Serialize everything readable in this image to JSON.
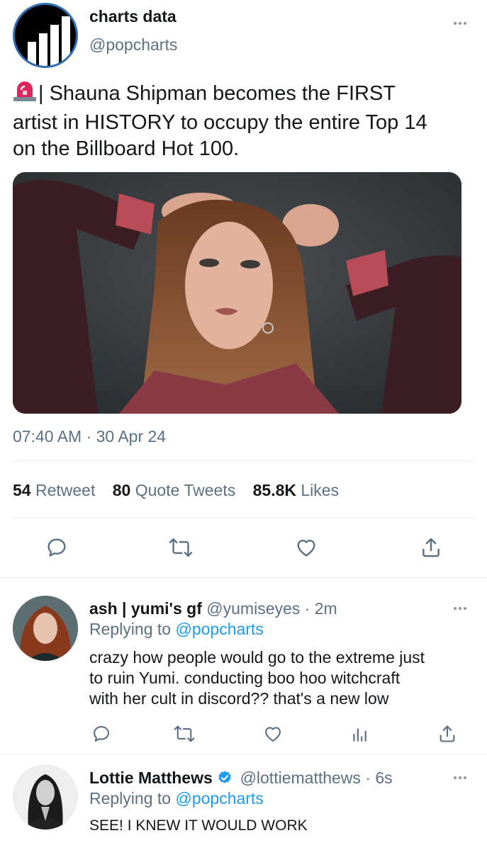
{
  "main_tweet": {
    "author_name": "charts data",
    "author_handle": "@popcharts",
    "siren_icon": "siren-emoji",
    "text_line1": "| Shauna Shipman becomes the FIRST",
    "text_line2": "artist in HISTORY to occupy the entire Top 14",
    "text_line3": "on the Billboard Hot 100.",
    "timestamp": "07:40 AM · 30 Apr 24",
    "retweets_count": "54",
    "retweets_label": "Retweet",
    "quotes_count": "80",
    "quotes_label": "Quote Tweets",
    "likes_count": "85.8K",
    "likes_label": "Likes"
  },
  "replies": [
    {
      "name": "ash | yumi's gf",
      "handle": "@yumiseyes",
      "time": "· 2m",
      "replying_prefix": "Replying to",
      "replying_to": "@popcharts",
      "text_line1": "crazy how people would go to the extreme just",
      "text_line2": "to ruin Yumi. conducting boo hoo witchcraft",
      "text_line3": "with her cult in discord?? that's a new low"
    },
    {
      "name": "Lottie Matthews",
      "handle": "@lottiematthews",
      "time": "· 6s",
      "replying_prefix": "Replying to",
      "replying_to": "@popcharts",
      "text_line1": "SEE! I KNEW IT WOULD WORK",
      "verified": true
    }
  ],
  "icons": [
    "reply-icon",
    "retweet-icon",
    "like-icon",
    "share-icon",
    "analytics-icon",
    "more-icon",
    "verified-icon"
  ],
  "colors": {
    "link": "#1d9bf0",
    "muted": "#5b7083",
    "text": "#14171a"
  }
}
